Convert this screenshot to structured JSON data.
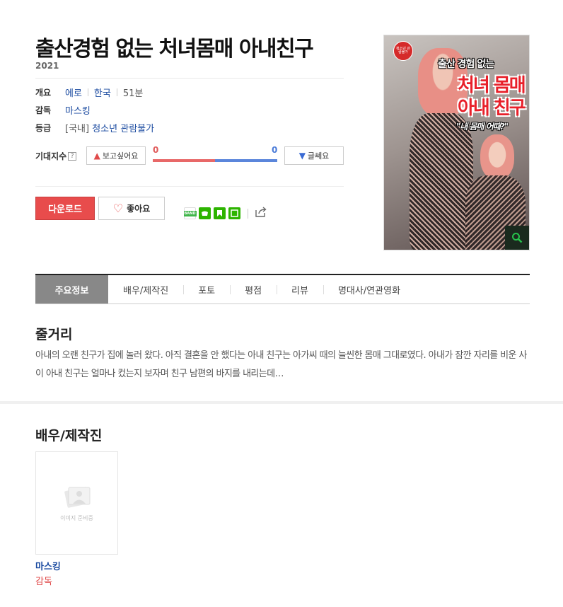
{
  "movie": {
    "title": "출산경험 없는 처녀몸매 아내친구",
    "year": "2021",
    "overview_label": "개요",
    "genre": "에로",
    "country": "한국",
    "runtime": "51분",
    "director_label": "감독",
    "director": "마스킹",
    "rating_label": "등급",
    "rating_prefix": "[국내]",
    "rating": "청소년 관람불가"
  },
  "expectation": {
    "label": "기대지수",
    "help": "?",
    "want_label": "보고싶어요",
    "want_count": "0",
    "meh_label": "글쎄요",
    "meh_count": "0",
    "want_ratio": 0.5
  },
  "actions": {
    "download_label": "다운로드",
    "like_label": "좋아요"
  },
  "share": {
    "icons": [
      "band-icon",
      "green-icon",
      "bookmark-icon",
      "line-icon",
      "share-icon"
    ],
    "band_text": "BAND"
  },
  "poster": {
    "badge": "청소년 관람불가",
    "line1": "출산 경험 없는",
    "line2": "처녀 몸매",
    "line3": "아내 친구",
    "line4": "\"내 몸매 어때?\""
  },
  "tabs": [
    "주요정보",
    "배우/제작진",
    "포토",
    "평점",
    "리뷰",
    "명대사/연관영화"
  ],
  "synopsis": {
    "title": "줄거리",
    "text": "아내의 오랜 친구가 집에 놀러 왔다. 아직 결혼을 안 했다는 아내 친구는 아가씨 때의 늘씬한 몸매 그대로였다. 아내가 잠깐 자리를 비운 사이 아내 친구는 얼마나 컸는지 보자며 친구 남편의 바지를 내리는데…"
  },
  "cast": {
    "title": "배우/제작진",
    "placeholder": "이미지 준비중",
    "members": [
      {
        "name": "마스킹",
        "role": "감독"
      }
    ]
  },
  "colors": {
    "accent": "#e84c4c",
    "link": "#1a4aa0",
    "want_bar": "#e86868",
    "meh_bar": "#5b86db"
  }
}
